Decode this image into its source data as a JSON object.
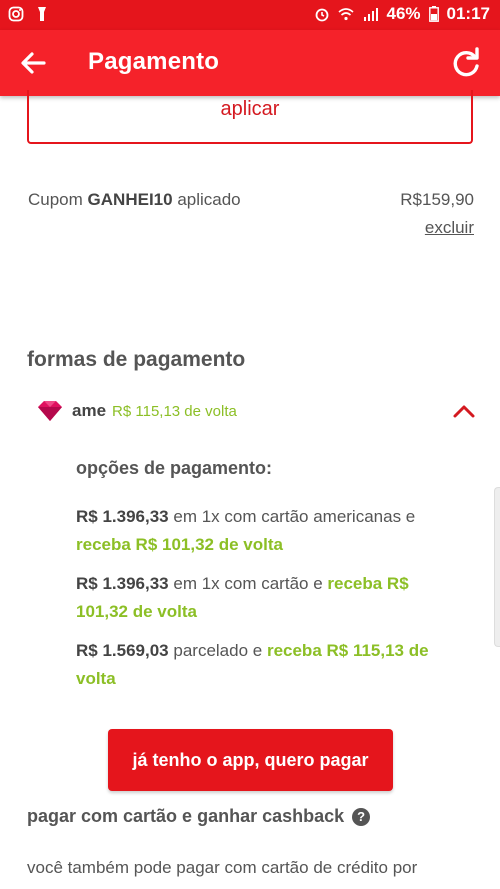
{
  "status_bar": {
    "battery": "46%",
    "time": "01:17",
    "icons": [
      "instagram-icon",
      "flashlight-icon",
      "alarm-icon",
      "wifi-icon",
      "signal-icon",
      "battery-icon"
    ]
  },
  "app_bar": {
    "title": "Pagamento",
    "back_icon": "arrow-left-icon",
    "refresh_icon": "refresh-icon"
  },
  "coupon": {
    "apply_label": "aplicar",
    "prefix": "Cupom",
    "code": "GANHEI10",
    "suffix": "aplicado",
    "price": "R$159,90",
    "remove_label": "excluir"
  },
  "payment": {
    "section_title": "formas de pagamento",
    "ame": {
      "name": "ame",
      "cashback": "R$ 115,13 de volta"
    },
    "options_title": "opções de pagamento:",
    "options": [
      {
        "amount": "R$ 1.396,33",
        "text": "em 1x com cartão americanas e",
        "cashback": "receba R$ 101,32 de volta"
      },
      {
        "amount": "R$ 1.396,33",
        "text": "em 1x com cartão e",
        "cashback": "receba R$ 101,32 de volta"
      },
      {
        "amount": "R$ 1.569,03",
        "text": "parcelado e",
        "cashback": "receba R$ 115,13 de volta"
      }
    ],
    "pay_button": "já tenho o app, quero pagar"
  },
  "card_cashback": {
    "title": "pagar com cartão e ganhar cashback",
    "help_icon": "?",
    "description": "você também pode pagar com cartão de crédito por"
  },
  "colors": {
    "brand_red": "#f5222a",
    "cashback_green": "#8cbf26",
    "ame_pink": "#e0115f"
  }
}
